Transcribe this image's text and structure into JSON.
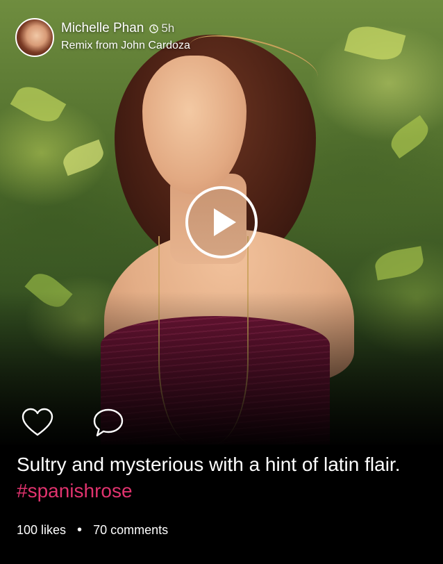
{
  "post": {
    "author": "Michelle Phan",
    "time": "5h",
    "remix_text": "Remix from John Cardoza",
    "caption_text": "Sultry and mysterious with a hint of latin flair.",
    "hashtag": "#spanishrose",
    "likes": "100 likes",
    "separator": "•",
    "comments": "70 comments"
  },
  "icons": {
    "avatar": "avatar",
    "clock": "clock-icon",
    "play": "play-icon",
    "like": "heart-icon",
    "comment": "comment-icon"
  },
  "colors": {
    "background": "#000000",
    "text": "#ffffff",
    "hashtag": "#e0336e"
  }
}
